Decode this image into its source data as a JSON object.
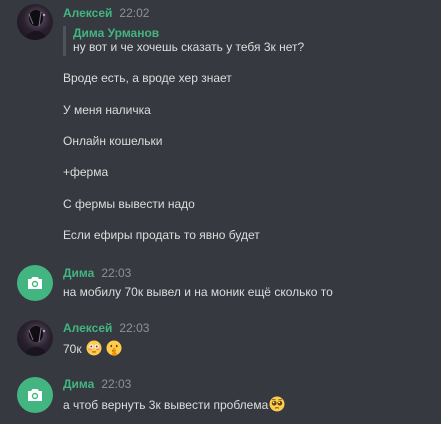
{
  "messages": [
    {
      "author": "Алексей",
      "time": "22:02",
      "reply": {
        "author": "Дима Урманов",
        "text": "ну вот и че хочешь сказать у тебя 3к нет?"
      },
      "lines": [
        "Вроде есть, а вроде хер знает",
        "У меня наличка",
        "Онлайн кошельки",
        "+ферма",
        "С фермы вывести надо",
        "Если ефиры продать то явно будет"
      ]
    },
    {
      "author": "Дима",
      "time": "22:03",
      "lines": [
        "на мобилу 70к вывел и на моник ещё сколько то"
      ]
    },
    {
      "author": "Алексей",
      "time": "22:03",
      "lines": [
        "70к"
      ],
      "emojis": [
        "flushed-face-emoji",
        "shushing-face-emoji"
      ]
    },
    {
      "author": "Дима",
      "time": "22:03",
      "lines": [
        "а чтоб вернуть 3к вывести проблема"
      ],
      "emojis": [
        "pleading-face-emoji"
      ]
    }
  ],
  "colors": {
    "background": "#36393f",
    "author": "#43b581",
    "timestamp": "#8e9297",
    "text": "#dcddde",
    "reply_bar": "#4f545c"
  },
  "icons": {
    "avatar_default": "camera-icon"
  }
}
